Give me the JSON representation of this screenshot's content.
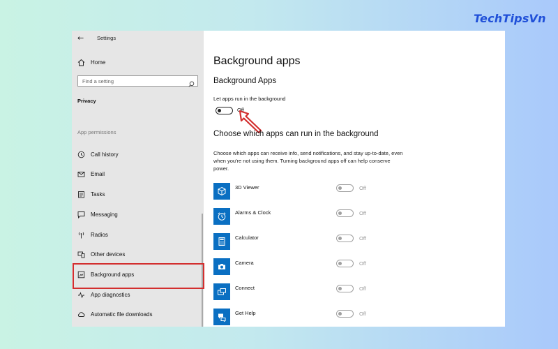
{
  "brand": "TechTipsVn",
  "window": {
    "title": "Settings"
  },
  "sidebar": {
    "home": "Home",
    "search_placeholder": "Find a setting",
    "category": "Privacy",
    "section": "App permissions",
    "items": [
      {
        "label": "Call history",
        "icon": "call-history-icon"
      },
      {
        "label": "Email",
        "icon": "email-icon"
      },
      {
        "label": "Tasks",
        "icon": "tasks-icon"
      },
      {
        "label": "Messaging",
        "icon": "messaging-icon"
      },
      {
        "label": "Radios",
        "icon": "radios-icon"
      },
      {
        "label": "Other devices",
        "icon": "other-devices-icon"
      },
      {
        "label": "Background apps",
        "icon": "background-apps-icon",
        "selected": true
      },
      {
        "label": "App diagnostics",
        "icon": "app-diagnostics-icon"
      },
      {
        "label": "Automatic file downloads",
        "icon": "cloud-download-icon"
      }
    ]
  },
  "main": {
    "page_title": "Background apps",
    "section_title": "Background Apps",
    "toggle_label": "Let apps run in the background",
    "toggle_state": "Off",
    "choose_title": "Choose which apps can run in the background",
    "description": "Choose which apps can receive info, send notifications, and stay up-to-date, even when you're not using them. Turning background apps off can help conserve power.",
    "apps": [
      {
        "name": "3D Viewer",
        "state": "Off",
        "icon": "cube-icon"
      },
      {
        "name": "Alarms & Clock",
        "state": "Off",
        "icon": "alarm-clock-icon"
      },
      {
        "name": "Calculator",
        "state": "Off",
        "icon": "calculator-icon"
      },
      {
        "name": "Camera",
        "state": "Off",
        "icon": "camera-icon"
      },
      {
        "name": "Connect",
        "state": "Off",
        "icon": "connect-icon"
      },
      {
        "name": "Get Help",
        "state": "Off",
        "icon": "help-chat-icon"
      }
    ]
  },
  "colors": {
    "accent": "#0a6fc2",
    "highlight": "#d32f2f",
    "brand": "#1f4fd8"
  }
}
